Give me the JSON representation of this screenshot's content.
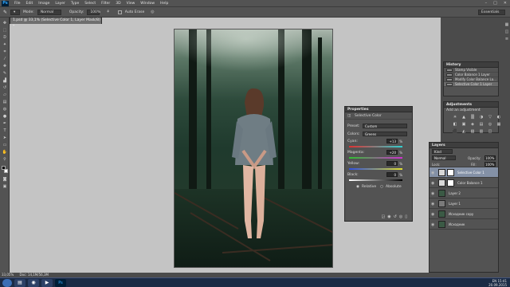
{
  "menubar": {
    "logo": "Ps",
    "items": [
      "File",
      "Edit",
      "Image",
      "Layer",
      "Type",
      "Select",
      "Filter",
      "3D",
      "View",
      "Window",
      "Help"
    ]
  },
  "options": {
    "mode_label": "Mode:",
    "mode_value": "Normal",
    "opacity_label": "Opacity:",
    "opacity_value": "100%",
    "autoerase_label": "Auto Erase",
    "workspace": "Essentials"
  },
  "document": {
    "tab_title": "1.psd @ 33,1% (Selective Color 1, Layer Mask/8) *"
  },
  "history": {
    "title": "History",
    "items": [
      "Stamp Visible",
      "Color Balance 1 Layer",
      "Modify Color Balance La...",
      "Selective Color 1 Layer"
    ]
  },
  "adjustments": {
    "title": "Adjustments",
    "subtitle": "Add an adjustment",
    "icons": [
      "☀",
      "▲",
      "▒",
      "◑",
      "▽",
      "◐",
      "◧",
      "▣",
      "◈",
      "▤",
      "◎",
      "▦",
      "⬛",
      "◭",
      "▧",
      "▥",
      "◫"
    ]
  },
  "properties": {
    "title": "Properties",
    "panel_name": "Selective Color",
    "preset_label": "Preset:",
    "preset_value": "Custom",
    "colors_label": "Colors:",
    "colors_value": "Greens",
    "sliders": [
      {
        "label": "Cyan:",
        "value": "+13",
        "pct": "%"
      },
      {
        "label": "Magenta:",
        "value": "+20",
        "pct": "%"
      },
      {
        "label": "Yellow:",
        "value": "0",
        "pct": "%"
      },
      {
        "label": "Black:",
        "value": "0",
        "pct": "%"
      }
    ],
    "relative_label": "Relative",
    "absolute_label": "Absolute"
  },
  "layers": {
    "title": "Layers",
    "kind_label": "Kind",
    "blend_value": "Normal",
    "opacity_label": "Opacity:",
    "opacity_value": "100%",
    "lock_label": "Lock:",
    "fill_label": "Fill:",
    "fill_value": "100%",
    "items": [
      "Selective Color 1",
      "Color Balance 1",
      "Layer 2",
      "Layer 1",
      "Исходник copy",
      "Исходник"
    ]
  },
  "statusbar": {
    "zoom": "33,05%",
    "doc": "Doc: 14,1M/56,3M"
  },
  "taskbar": {
    "lang": "EN",
    "time": "15:41",
    "date": "20.09.2015"
  }
}
